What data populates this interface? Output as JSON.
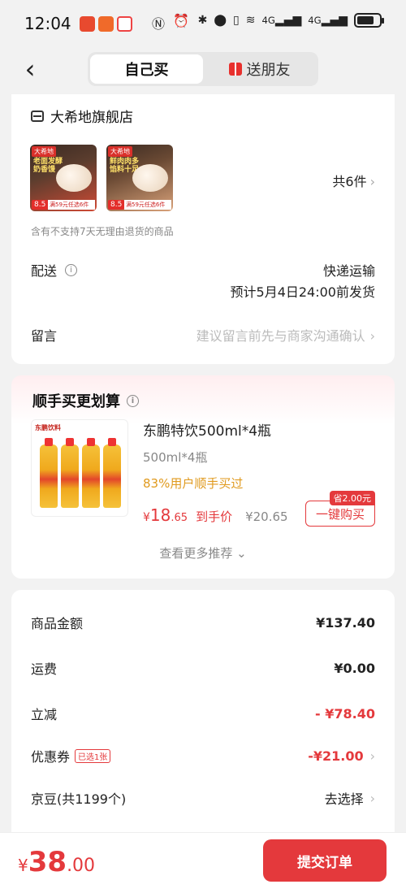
{
  "status_bar": {
    "time": "12:04",
    "network_1": "4G",
    "network_2": "4G"
  },
  "nav": {
    "tab_self": "自己买",
    "tab_gift": "送朋友"
  },
  "store": {
    "name": "大希地旗舰店",
    "item_count": "共6件",
    "thumb1": {
      "brand": "大希地",
      "title": "老面发酵奶香馒",
      "badge": "8.5",
      "promo": "满59元任选6件"
    },
    "thumb2": {
      "brand": "大希地",
      "title": "鲜肉肉多馅料十足",
      "badge": "8.5",
      "promo": "满59元任选6件"
    },
    "return_note": "含有不支持7天无理由退货的商品",
    "delivery_label": "配送",
    "delivery_method": "快递运输",
    "delivery_estimate": "预计5月4日24:00前发货",
    "message_label": "留言",
    "message_placeholder": "建议留言前先与商家沟通确认"
  },
  "recommend": {
    "title": "顺手买更划算",
    "product": {
      "brand": "东鹏饮料",
      "name": "东鹏特饮500ml*4瓶",
      "spec": "500ml*4瓶",
      "users_note": "83%用户顺手买过",
      "price_yen": "¥",
      "price_int": "18",
      "price_dec": ".65",
      "price_label": "到手价",
      "original_price": "¥20.65",
      "save_badge": "省2.00元",
      "buy_label": "一键购买"
    },
    "more_label": "查看更多推荐 ⌄"
  },
  "summary": {
    "goods_label": "商品金额",
    "goods_value": "¥137.40",
    "shipping_label": "运费",
    "shipping_value": "¥0.00",
    "discount_label": "立减",
    "discount_value": "- ¥78.40",
    "coupon_label": "优惠券",
    "coupon_tag": "已选1张",
    "coupon_value": "-¥21.00",
    "beans_label": "京豆(共1199个)",
    "beans_value": "去选择"
  },
  "bottom": {
    "yen": "¥",
    "total_int": "38",
    "total_dec": ".00",
    "submit_label": "提交订单"
  },
  "colors": {
    "accent": "#e4393c",
    "orange": "#e09a1e"
  }
}
